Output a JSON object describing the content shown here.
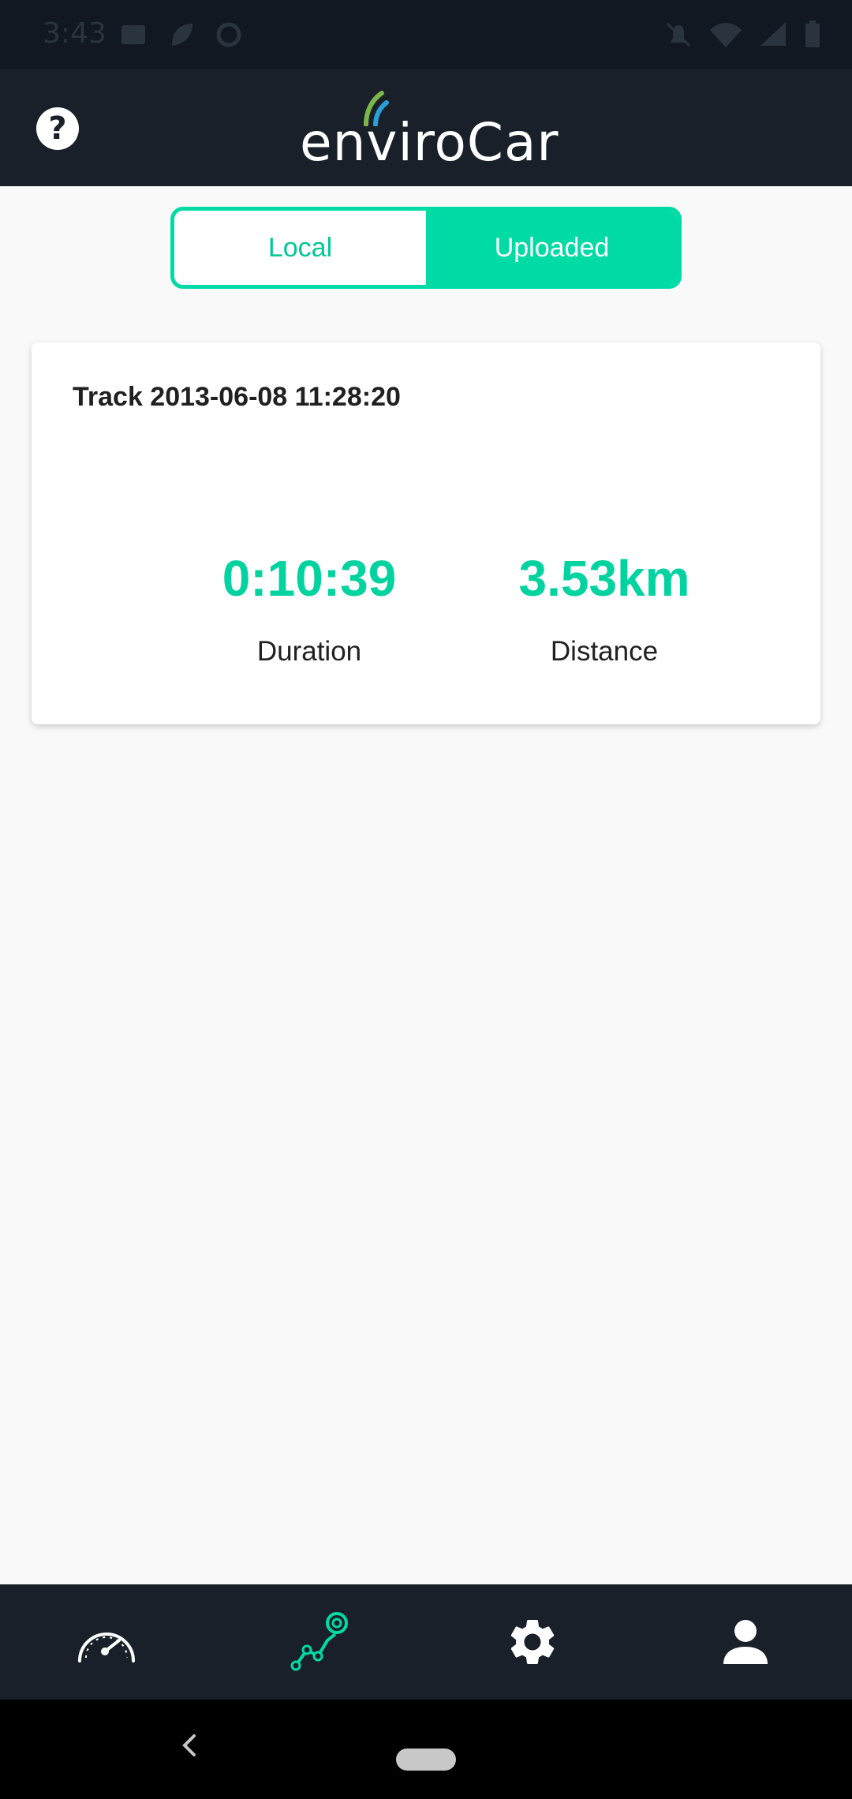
{
  "status_bar": {
    "time": "3:43",
    "left_icons": [
      "image-icon",
      "leaf-icon",
      "sync-icon"
    ],
    "right_icons": [
      "bell-off-icon",
      "wifi-icon",
      "signal-icon",
      "battery-icon"
    ]
  },
  "app_bar": {
    "help_icon_label": "?",
    "logo_text": "enviroCar"
  },
  "tabs": {
    "local_label": "Local",
    "uploaded_label": "Uploaded",
    "selected": "Uploaded"
  },
  "tracks": [
    {
      "title": "Track 2013-06-08 11:28:20",
      "duration": "0:10:39",
      "duration_label": "Duration",
      "distance": "3.53km",
      "distance_label": "Distance"
    }
  ],
  "bottom_nav": {
    "items": [
      "speedometer-icon",
      "tracks-icon",
      "settings-icon",
      "profile-icon"
    ],
    "active": "tracks-icon"
  },
  "colors": {
    "accent": "#00dba6",
    "header_bg": "#1a2029",
    "status_bg": "#111821",
    "background": "#f9f9f9"
  }
}
